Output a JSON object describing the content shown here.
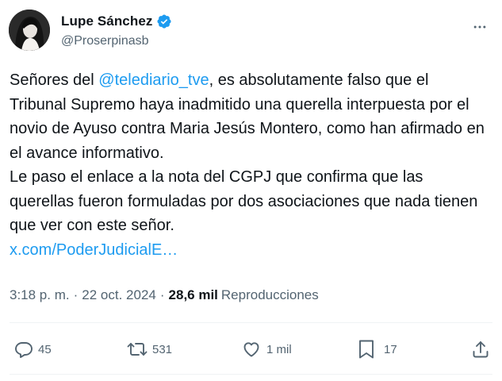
{
  "author": {
    "display_name": "Lupe Sánchez",
    "handle": "@Proserpinasb",
    "verified": true
  },
  "tweet": {
    "line1_before": "Señores del ",
    "mention": "@telediario_tve",
    "line1_after": ", es absolutamente falso que el Tribunal Supremo haya inadmitido una querella interpuesta por el novio de Ayuso contra Maria Jesús Montero, como han afirmado en el avance informativo.",
    "paragraph2": "Le paso el enlace a la nota del CGPJ que confirma que las querellas fueron formuladas por dos asociaciones que nada tienen que ver con este señor.",
    "link": "x.com/PoderJudicialE…"
  },
  "meta": {
    "time": "3:18 p. m.",
    "date": "22 oct. 2024",
    "views_count": "28,6 mil",
    "views_label": "Reproducciones",
    "separator": "·"
  },
  "actions": {
    "replies": "45",
    "reposts": "531",
    "likes": "1 mil",
    "bookmarks": "17"
  },
  "colors": {
    "accent": "#1d9bf0",
    "text": "#0f1419",
    "secondary": "#536471",
    "divider": "#eff3f4"
  },
  "icons": {
    "verified": "verified-badge-icon",
    "more": "more-dots-icon",
    "reply": "reply-bubble-icon",
    "repost": "repost-arrows-icon",
    "like": "heart-icon",
    "bookmark": "bookmark-icon",
    "share": "share-upload-icon"
  }
}
